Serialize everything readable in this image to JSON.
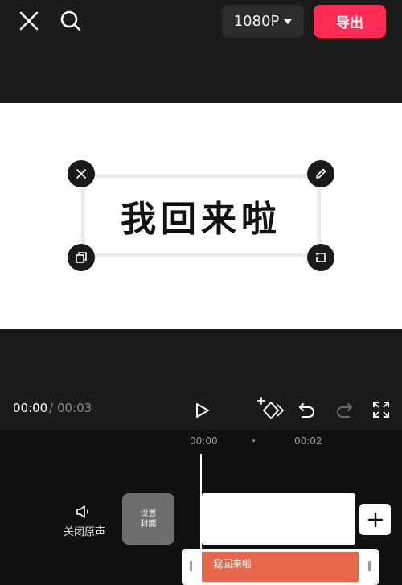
{
  "toolbar": {
    "resolution_label": "1080P",
    "export_label": "导出"
  },
  "canvas": {
    "caption_text": "我回来啦"
  },
  "playback": {
    "current_time": "00:00",
    "separator": "/",
    "total_time": "00:03"
  },
  "timeline": {
    "ruler_ticks": [
      "00:00",
      "00:02"
    ],
    "mute_label": "关闭原声",
    "cover_label_line1": "设置",
    "cover_label_line2": "封面",
    "text_clip_label": "我回来啦"
  },
  "icons": {
    "close": "close-icon",
    "search": "search-icon",
    "dropdown": "caret-down-icon",
    "delete": "close-icon",
    "edit": "pencil-icon",
    "copy": "copy-icon",
    "rotate": "rotate-scale-icon",
    "play": "play-icon",
    "keyframe": "add-keyframe-icon",
    "undo": "undo-icon",
    "redo": "redo-icon",
    "fullscreen": "fullscreen-icon",
    "speaker": "speaker-icon",
    "add": "plus-icon"
  },
  "colors": {
    "background": "#1b1b1b",
    "export_accent": "#fe2c55",
    "text_clip": "#e8674c",
    "timeline_bg": "#111111"
  }
}
